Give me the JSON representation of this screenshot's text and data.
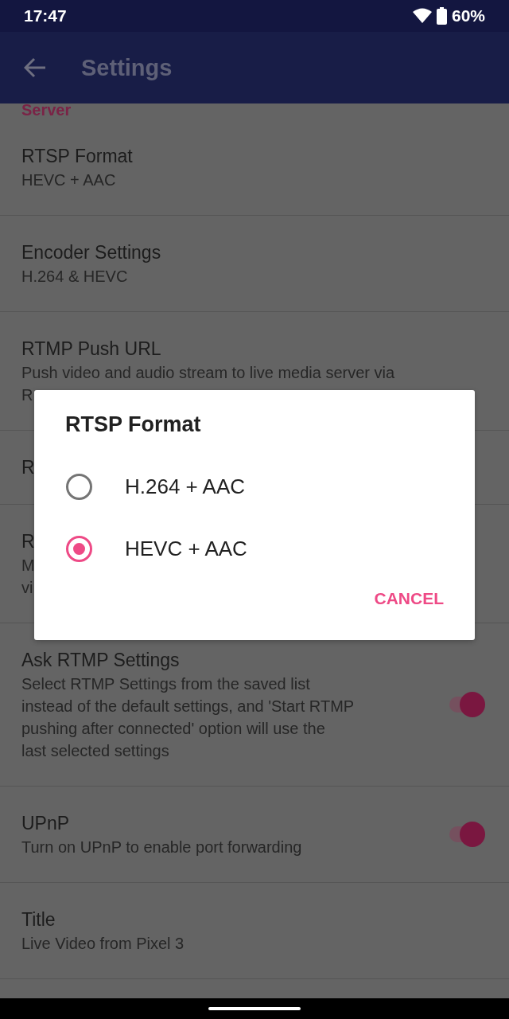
{
  "status_bar": {
    "time": "17:47",
    "battery": "60%"
  },
  "app_bar": {
    "title": "Settings"
  },
  "section": {
    "title": "Server"
  },
  "rows": [
    {
      "kind": "text",
      "title": "RTSP Format",
      "subtitle": [
        "HEVC + AAC"
      ]
    },
    {
      "kind": "text",
      "title": "Encoder Settings",
      "subtitle": [
        "H.264 & HEVC"
      ]
    },
    {
      "kind": "text",
      "title": "RTMP Push URL",
      "subtitle": [
        "Push video and audio stream to live media server via",
        "R"
      ]
    },
    {
      "kind": "text",
      "title": "R"
    },
    {
      "kind": "text",
      "title": "R",
      "subtitle": [
        "M",
        "vi"
      ]
    },
    {
      "kind": "switch",
      "title": "Ask RTMP Settings",
      "subtitle": [
        "Select RTMP Settings from the saved list",
        "instead of the default settings, and 'Start RTMP",
        "pushing after connected' option will use the",
        "last selected settings"
      ],
      "on": true
    },
    {
      "kind": "switch",
      "title": "UPnP",
      "subtitle": [
        "Turn on UPnP to enable port forwarding"
      ],
      "on": true
    },
    {
      "kind": "text",
      "title": "Title",
      "subtitle": [
        "Live Video from Pixel 3"
      ]
    }
  ],
  "dialog": {
    "title": "RTSP Format",
    "options": [
      {
        "label": "H.264 + AAC",
        "selected": false
      },
      {
        "label": "HEVC + AAC",
        "selected": true
      }
    ],
    "button": "CANCEL"
  }
}
